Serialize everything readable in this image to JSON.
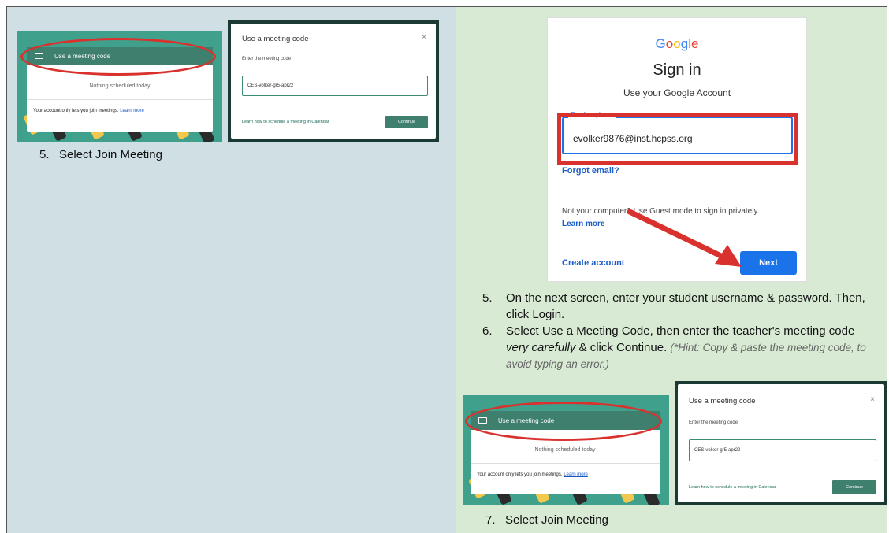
{
  "meeting_card": {
    "bar_label": "Use a meeting code",
    "nothing": "Nothing scheduled today",
    "account_info": "Your account only lets you join meetings.",
    "learn_more": "Learn more"
  },
  "dialog": {
    "title": "Use a meeting code",
    "close": "×",
    "prompt": "Enter the meeting code",
    "code_value": "CES-volker-gr5-apr22",
    "learn_link": "Learn how to schedule a meeting in Calendar",
    "continue": "Continue"
  },
  "left_step": "5.   Select Join Meeting",
  "google": {
    "logo_letters": [
      "G",
      "o",
      "o",
      "g",
      "l",
      "e"
    ],
    "logo_colors": [
      "#4285F4",
      "#EA4335",
      "#FBBC05",
      "#4285F4",
      "#34A853",
      "#EA4335"
    ],
    "heading": "Sign in",
    "subheading": "Use your Google Account",
    "email_label": "Email or phone",
    "email_value": "evolker9876@inst.hcpss.org",
    "forgot": "Forgot email?",
    "guest_text": "Not your computer? Use Guest mode to sign in privately.",
    "learn_more": "Learn more",
    "create": "Create account",
    "next": "Next"
  },
  "instructions": [
    {
      "num": "5.",
      "text": "On the next screen, enter your student username & password. Then, click Login."
    },
    {
      "num": "6.",
      "pre": "Select Use a Meeting Code, then enter the teacher's meeting code ",
      "em": "very carefully",
      "mid": " & click Continue. ",
      "hint": "(*Hint: Copy & paste the meeting code, to avoid typing an error.)"
    }
  ],
  "right_step": "7.   Select Join Meeting"
}
